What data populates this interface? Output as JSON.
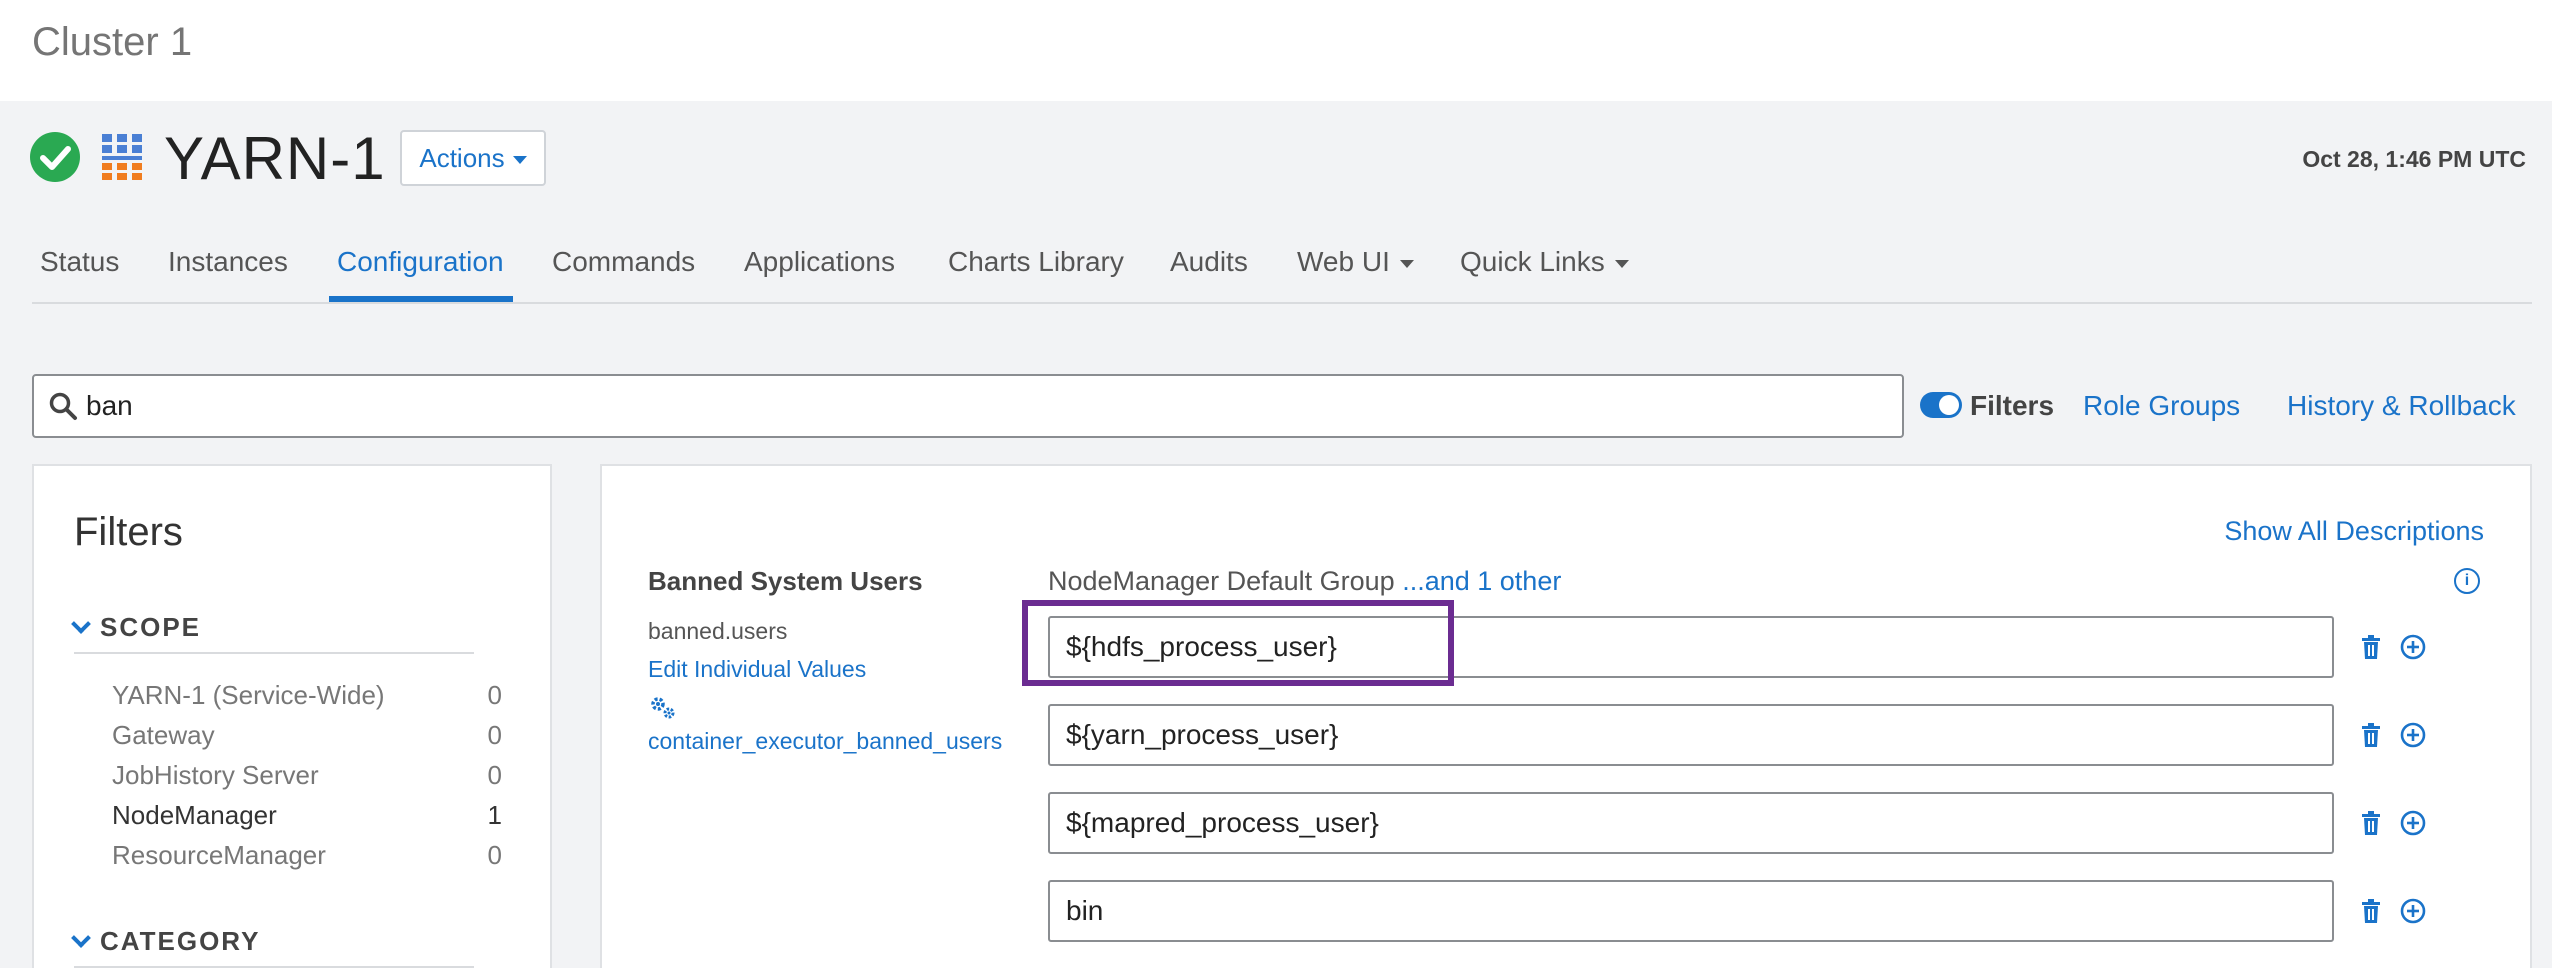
{
  "cluster": {
    "title": "Cluster 1"
  },
  "service": {
    "name": "YARN-1",
    "status_icon": "check-circle-icon",
    "logo_icon": "yarn-logo-icon"
  },
  "header": {
    "actions_label": "Actions",
    "timestamp": "Oct 28, 1:46 PM UTC"
  },
  "tabs": [
    {
      "label": "Status"
    },
    {
      "label": "Instances"
    },
    {
      "label": "Configuration",
      "active": true
    },
    {
      "label": "Commands"
    },
    {
      "label": "Applications"
    },
    {
      "label": "Charts Library"
    },
    {
      "label": "Audits"
    },
    {
      "label": "Web UI",
      "dropdown": true
    },
    {
      "label": "Quick Links",
      "dropdown": true
    }
  ],
  "search": {
    "value": "ban",
    "icon": "search-icon"
  },
  "toolbar": {
    "filters_label": "Filters",
    "filters_enabled": true,
    "role_groups_label": "Role Groups",
    "history_label": "History & Rollback"
  },
  "filters": {
    "title": "Filters",
    "scope": {
      "label": "SCOPE",
      "items": [
        {
          "label": "YARN-1 (Service-Wide)",
          "count": "0"
        },
        {
          "label": "Gateway",
          "count": "0"
        },
        {
          "label": "JobHistory Server",
          "count": "0"
        },
        {
          "label": "NodeManager",
          "count": "1"
        },
        {
          "label": "ResourceManager",
          "count": "0"
        }
      ]
    },
    "category": {
      "label": "CATEGORY"
    }
  },
  "config": {
    "show_all_descriptions": "Show All Descriptions",
    "property": {
      "display_name": "Banned System Users",
      "key": "banned.users",
      "edit_individual": "Edit Individual Values",
      "alias": "container_executor_banned_users",
      "group": "NodeManager Default Group",
      "group_more": "...and 1 other",
      "values": [
        "${hdfs_process_user}",
        "${yarn_process_user}",
        "${mapred_process_user}",
        "bin"
      ]
    }
  },
  "colors": {
    "accent": "#1a73c9",
    "success": "#2aa952",
    "highlight": "#6b2c91"
  }
}
